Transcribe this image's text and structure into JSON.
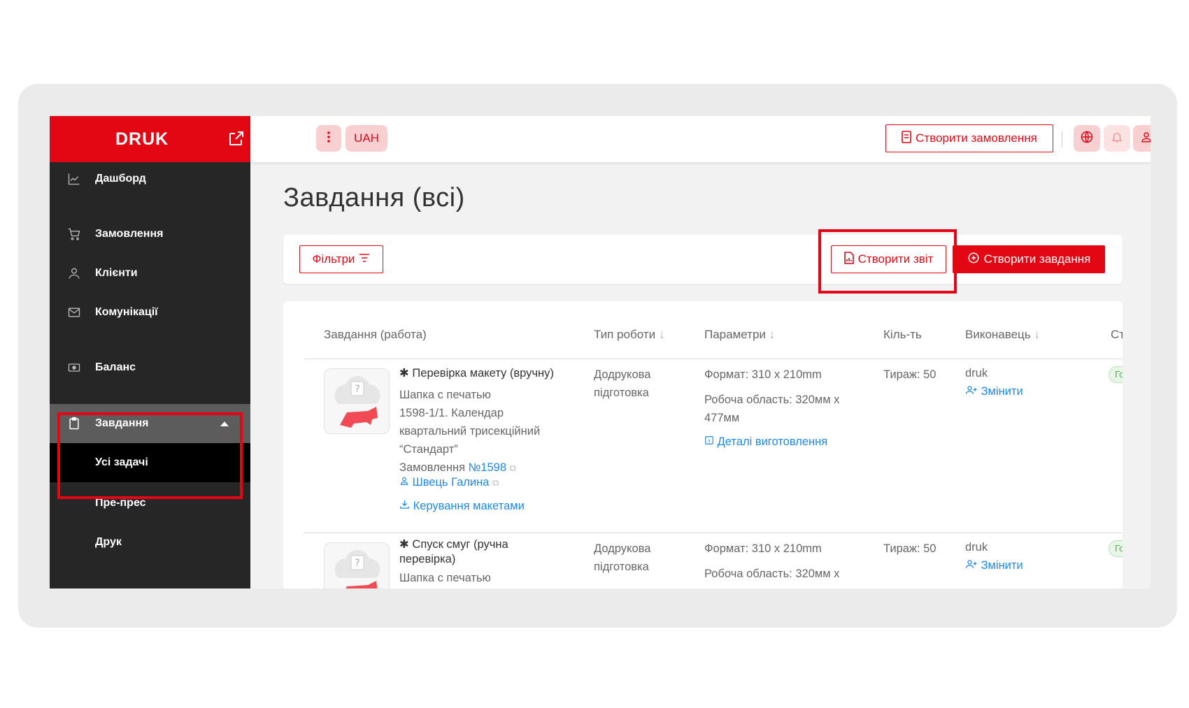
{
  "brand": {
    "name": "DRUK"
  },
  "sidebar": {
    "items": [
      {
        "label": "Дашборд",
        "icon": "chart-icon"
      },
      {
        "label": "Замовлення",
        "icon": "cart-icon"
      },
      {
        "label": "Клієнти",
        "icon": "user-icon"
      },
      {
        "label": "Комунікації",
        "icon": "mail-icon"
      },
      {
        "label": "Баланс",
        "icon": "wallet-icon"
      },
      {
        "label": "Завдання",
        "icon": "clipboard-icon"
      }
    ],
    "sub_items": [
      {
        "label": "Усі задачі"
      },
      {
        "label": "Пре-прес"
      },
      {
        "label": "Друк"
      }
    ]
  },
  "header": {
    "currency": "UAH",
    "create_order_label": "Створити замовлення"
  },
  "main": {
    "title": "Завдання (всі)",
    "filters_label": "Фільтри",
    "create_report_label": "Створити звіт",
    "create_task_label": "Створити завдання",
    "columns": [
      "Завдання (работа)",
      "Тип роботи",
      "Параметри",
      "Кіль-ть",
      "Виконавець",
      "Ст"
    ],
    "rows": [
      {
        "title": "Перевірка макету (вручну)",
        "desc_lines": [
          "Шапка с печатью",
          "1598-1/1. Календар",
          "квартальний трисекційний",
          "“Стандарт”"
        ],
        "order_label": "Замовлення",
        "order_number": "№1598",
        "client": "Швець Галина",
        "layouts_link": "Керування макетами",
        "work_type_lines": [
          "Додрукова",
          "підготовка"
        ],
        "format": "Формат: 310 х 210mm",
        "work_area_lines": [
          "Робоча область: 320мм х",
          "477мм"
        ],
        "details_link": "Деталі виготовлення",
        "quantity": "Тираж: 50",
        "executor": "druk",
        "change_link": "Змінити",
        "status": "Го"
      },
      {
        "title_lines": [
          "Спуск смуг (ручна",
          "перевірка)"
        ],
        "desc_lines": [
          "Шапка с печатью"
        ],
        "work_type_lines": [
          "Додрукова",
          "підготовка"
        ],
        "format": "Формат: 310 х 210mm",
        "work_area_lines": [
          "Робоча область: 320мм х"
        ],
        "quantity": "Тираж: 50",
        "executor": "druk",
        "change_link": "Змінити",
        "status": "Го"
      }
    ]
  },
  "colors": {
    "accent": "#e30613",
    "sidebar": "#262626",
    "link": "#1e88e5"
  }
}
